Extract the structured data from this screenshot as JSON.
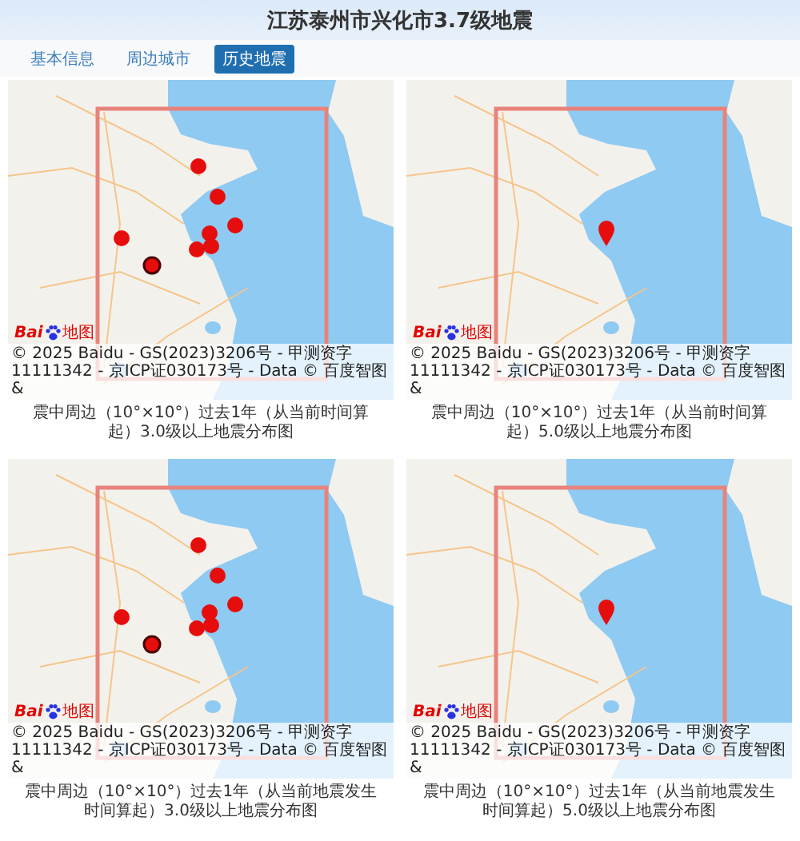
{
  "header": {
    "title": "江苏泰州市兴化市3.7级地震"
  },
  "tabs": [
    {
      "label": "基本信息",
      "selected": false
    },
    {
      "label": "周边城市",
      "selected": false
    },
    {
      "label": "历史地震",
      "selected": true
    }
  ],
  "maps": [
    {
      "markers": [
        {
          "kind": "dot"
        },
        {
          "kind": "dot"
        },
        {
          "kind": "dot"
        },
        {
          "kind": "dot"
        },
        {
          "kind": "dot"
        },
        {
          "kind": "dot"
        },
        {
          "kind": "dot"
        },
        {
          "kind": "ringed-dot"
        }
      ],
      "logo": [
        "Bai",
        "地图"
      ],
      "copyright": "© 2025 Baidu - GS(2023)3206号 - 甲测资字11111342 - 京ICP证030173号 - Data © 百度智图 &",
      "caption": "震中周边（10°×10°）过去1年（从当前时间算起）3.0级以上地震分布图"
    },
    {
      "markers": [
        {
          "kind": "pin"
        }
      ],
      "logo": [
        "Bai",
        "地图"
      ],
      "copyright": "© 2025 Baidu - GS(2023)3206号 - 甲测资字11111342 - 京ICP证030173号 - Data © 百度智图 &",
      "caption": "震中周边（10°×10°）过去1年（从当前时间算起）5.0级以上地震分布图"
    },
    {
      "markers": [
        {
          "kind": "dot"
        },
        {
          "kind": "dot"
        },
        {
          "kind": "dot"
        },
        {
          "kind": "dot"
        },
        {
          "kind": "dot"
        },
        {
          "kind": "dot"
        },
        {
          "kind": "dot"
        },
        {
          "kind": "ringed-dot"
        }
      ],
      "logo": [
        "Bai",
        "地图"
      ],
      "copyright": "© 2025 Baidu - GS(2023)3206号 - 甲测资字11111342 - 京ICP证030173号 - Data © 百度智图 &",
      "caption": "震中周边（10°×10°）过去1年（从当前地震发生时间算起）3.0级以上地震分布图"
    },
    {
      "markers": [
        {
          "kind": "pin"
        }
      ],
      "logo": [
        "Bai",
        "地图"
      ],
      "copyright": "© 2025 Baidu - GS(2023)3206号 - 甲测资字11111342 - 京ICP证030173号 - Data © 百度智图 &",
      "caption": "震中周边（10°×10°）过去1年（从当前地震发生时间算起）5.0级以上地震分布图"
    }
  ]
}
